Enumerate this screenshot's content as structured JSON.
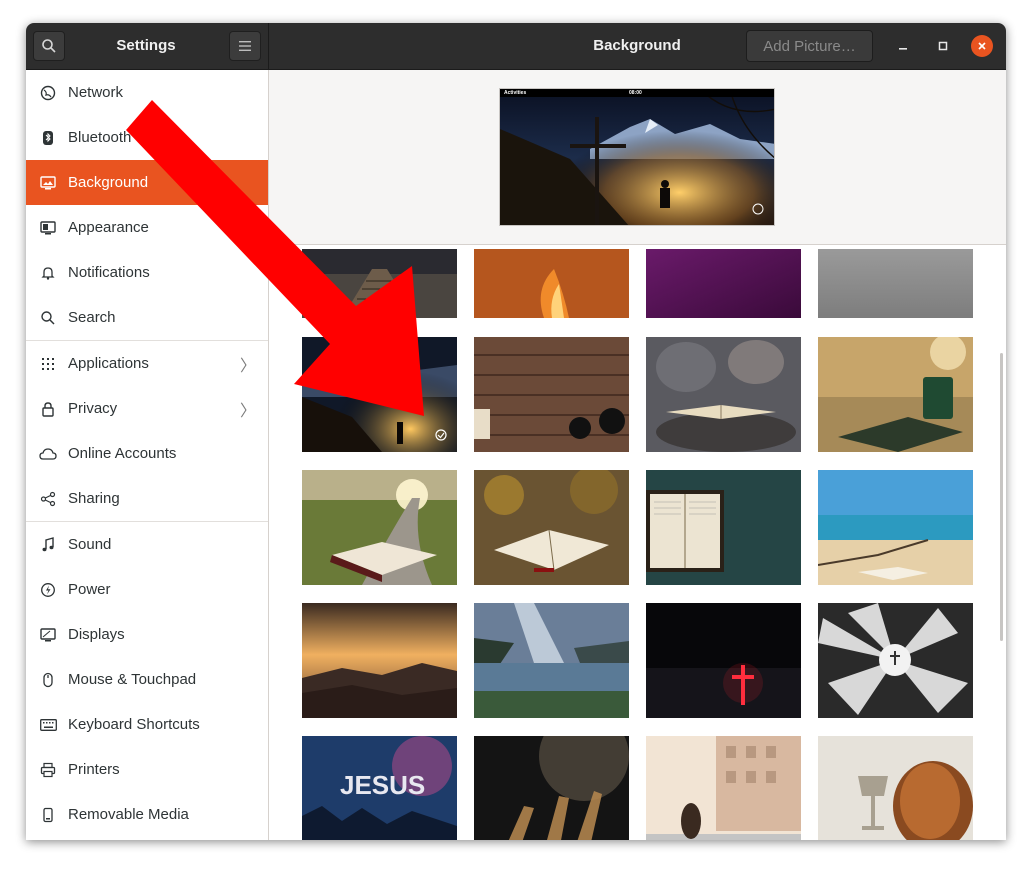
{
  "window": {
    "sidebar_title": "Settings",
    "page_title": "Background",
    "add_picture_label": "Add Picture…"
  },
  "preview": {
    "topbar_left": "Activities",
    "topbar_clock": "08:00"
  },
  "sidebar": {
    "items": [
      {
        "label": "Network",
        "icon": "network-icon"
      },
      {
        "label": "Bluetooth",
        "icon": "bluetooth-icon"
      },
      {
        "label": "Background",
        "icon": "background-icon",
        "active": true
      },
      {
        "label": "Appearance",
        "icon": "appearance-icon"
      },
      {
        "label": "Notifications",
        "icon": "bell-icon"
      },
      {
        "label": "Search",
        "icon": "search-icon"
      },
      {
        "label": "Applications",
        "icon": "apps-grid-icon",
        "has_submenu": true
      },
      {
        "label": "Privacy",
        "icon": "lock-icon",
        "has_submenu": true
      },
      {
        "label": "Online Accounts",
        "icon": "cloud-icon"
      },
      {
        "label": "Sharing",
        "icon": "share-icon"
      },
      {
        "label": "Sound",
        "icon": "music-note-icon"
      },
      {
        "label": "Power",
        "icon": "power-icon"
      },
      {
        "label": "Displays",
        "icon": "display-icon"
      },
      {
        "label": "Mouse & Touchpad",
        "icon": "mouse-icon"
      },
      {
        "label": "Keyboard Shortcuts",
        "icon": "keyboard-icon"
      },
      {
        "label": "Printers",
        "icon": "printer-icon"
      },
      {
        "label": "Removable Media",
        "icon": "usb-drive-icon"
      }
    ]
  },
  "wallpapers": {
    "rows": [
      [
        "Wooden bridge",
        "Orange flame abstract",
        "Purple gradient",
        "Grey gradient"
      ],
      [
        "Cross on mountain at night (current)",
        "Wood table with coffee",
        "Open book on stones",
        "Green mug with book"
      ],
      [
        "Bible on pathway",
        "Bible on rock in autumn",
        "Bible on teal background",
        "Bible on beach"
      ],
      [
        "Sun rays over hills",
        "Light beam over lake",
        "Neon cross in dark",
        "Cross in white shards"
      ],
      [
        "Jesus concert",
        "Hands raised in dark",
        "Girl and building",
        "Bread and chalice"
      ]
    ]
  },
  "colors": {
    "accent": "#e95420",
    "titlebar": "#2d2d2d",
    "annotation_arrow": "#ff0000"
  }
}
